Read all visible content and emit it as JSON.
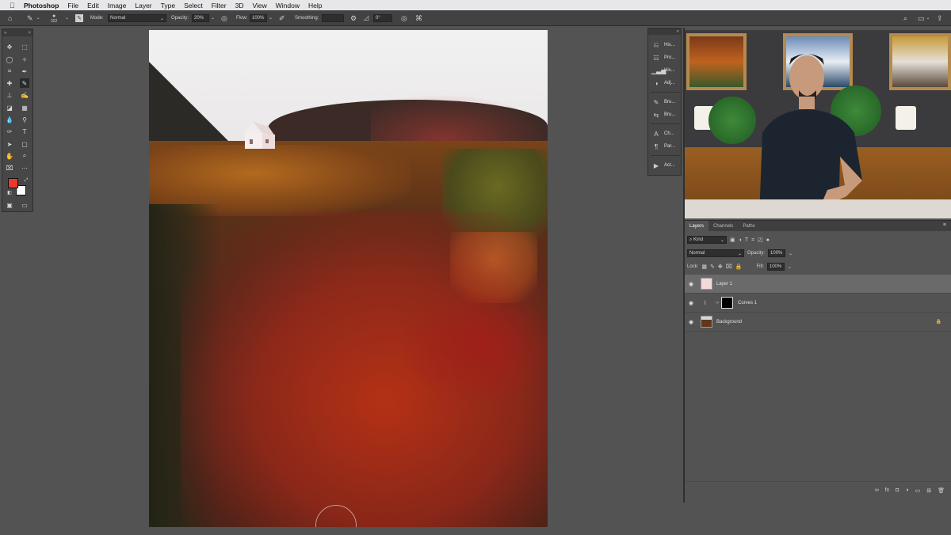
{
  "menubar": {
    "apple": "",
    "app_name": "Photoshop",
    "items": [
      "File",
      "Edit",
      "Image",
      "Layer",
      "Type",
      "Select",
      "Filter",
      "3D",
      "View",
      "Window",
      "Help"
    ]
  },
  "options_bar": {
    "brush_size": "322",
    "mode_label": "Mode:",
    "mode_value": "Normal",
    "opacity_label": "Opacity:",
    "opacity_value": "20%",
    "flow_label": "Flow:",
    "flow_value": "100%",
    "smoothing_label": "Smoothing:",
    "angle_value": "0°"
  },
  "colors": {
    "foreground": "#e8392a",
    "background": "#ffffff"
  },
  "dock": {
    "items": [
      {
        "icon": "history-icon",
        "label": "His..."
      },
      {
        "icon": "properties-icon",
        "label": "Pro..."
      },
      {
        "icon": "histogram-icon",
        "label": "His..."
      },
      {
        "icon": "adjustments-icon",
        "label": "Adj..."
      },
      {
        "icon": "brush-settings-icon",
        "label": "Bru..."
      },
      {
        "icon": "brushes-icon",
        "label": "Bru..."
      },
      {
        "icon": "character-icon",
        "label": "Ch..."
      },
      {
        "icon": "paragraph-icon",
        "label": "Par..."
      },
      {
        "icon": "actions-icon",
        "label": "Act..."
      }
    ]
  },
  "layers_panel": {
    "tabs": [
      "Layers",
      "Channels",
      "Paths"
    ],
    "kind_label": "Kind",
    "blend_mode": "Normal",
    "opacity_label": "Opacity:",
    "opacity_value": "100%",
    "lock_label": "Lock:",
    "fill_label": "Fill:",
    "fill_value": "100%",
    "layers": [
      {
        "name": "Layer 1",
        "selected": true
      },
      {
        "name": "Curves 1",
        "selected": false
      },
      {
        "name": "Background",
        "selected": false,
        "locked": true
      }
    ]
  }
}
